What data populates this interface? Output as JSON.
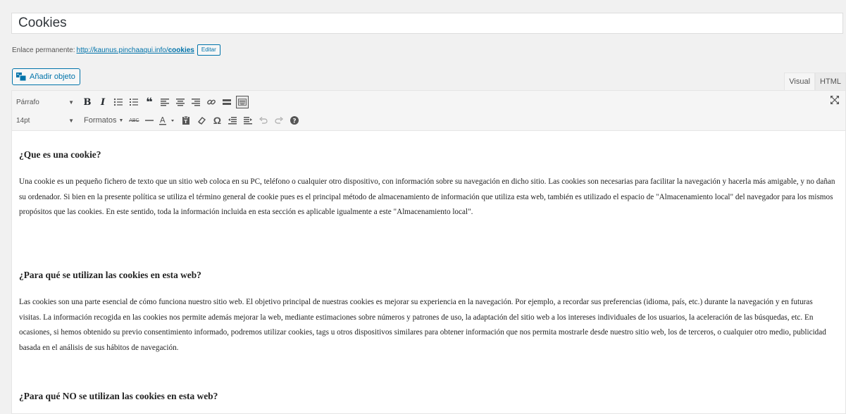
{
  "post": {
    "title": "Cookies",
    "permalink_label": "Enlace permanente:",
    "permalink_base": "http://kaunus.pinchaaqui.info/",
    "permalink_slug": "cookies",
    "edit_label": "Editar"
  },
  "media": {
    "add_label": "Añadir objeto"
  },
  "tabs": [
    {
      "label": "Visual"
    },
    {
      "label": "HTML"
    }
  ],
  "toolbar": {
    "format_select": "Párrafo",
    "fontsize_select": "14pt",
    "formats_label": "Formatos",
    "row1_icons": [
      "bold-icon",
      "italic-icon",
      "bulleted-list-icon",
      "numbered-list-icon",
      "blockquote-icon",
      "align-left-icon",
      "align-center-icon",
      "align-right-icon",
      "link-icon",
      "read-more-icon",
      "toolbar-toggle-icon"
    ],
    "row2_icons": [
      "strikethrough-icon",
      "horizontal-line-icon",
      "text-color-icon",
      "paste-text-icon",
      "clear-formatting-icon",
      "special-character-icon",
      "outdent-icon",
      "indent-icon",
      "undo-icon",
      "redo-icon",
      "help-icon"
    ]
  },
  "content": {
    "heading1": "¿Que es una cookie?",
    "para1": "Una cookie es un pequeño fichero de texto que un sitio web coloca en su PC, teléfono o cualquier otro dispositivo, con información sobre su navegación en dicho sitio. Las cookies son necesarias para facilitar la navegación y hacerla más amigable, y no dañan su ordenador. Si bien en la presente política se utiliza el término general de cookie pues es el principal método de almacenamiento de información que utiliza esta web, también es utilizado el espacio de \"Almacenamiento local\" del navegador para los mismos propósitos que las cookies. En este sentido, toda la información incluida en esta sección es aplicable igualmente a este \"Almacenamiento local\".",
    "heading2": "¿Para qué se utilizan las cookies en esta web?",
    "para2": "Las cookies son una parte esencial de cómo funciona nuestro sitio web. El objetivo principal de nuestras cookies es mejorar su experiencia en la navegación. Por ejemplo, a recordar sus preferencias (idioma, país, etc.) durante la navegación y en futuras visitas. La información recogida en las cookies nos permite además mejorar la web, mediante estimaciones sobre números y patrones de uso, la adaptación del sitio web a los intereses individuales de los usuarios, la aceleración de las búsquedas, etc. En ocasiones, si hemos obtenido su previo consentimiento informado, podremos utilizar cookies, tags u otros dispositivos similares para obtener información que nos permita mostrarle desde nuestro sitio web, los de terceros, o cualquier otro medio, publicidad basada en el análisis de sus hábitos de navegación.",
    "heading3": "¿Para qué NO se utilizan las cookies en esta web?"
  }
}
